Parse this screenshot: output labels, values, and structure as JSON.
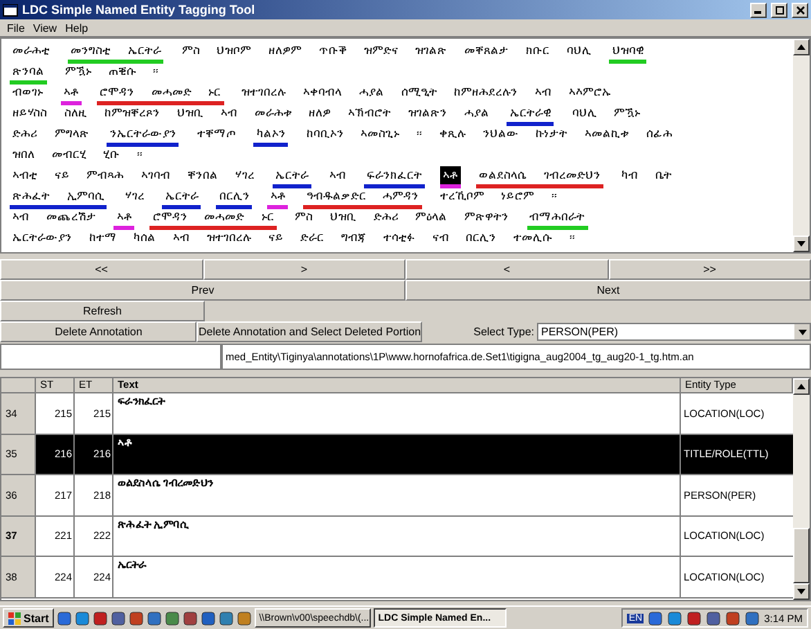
{
  "window": {
    "title": "LDC Simple Named Entity Tagging Tool"
  },
  "menu": [
    "File",
    "View",
    "Help"
  ],
  "document": {
    "lines": [
      [
        {
          "text": "መራሕቲ",
          "selected": false
        },
        {
          "text": "መንግስቲ ኤርትራ",
          "color": "#22cc22",
          "selected": false
        },
        {
          "text": "ምስ ህዝቦም ዘለዎም ጥቡቕ ዝምድና ዝገልጽ መቐጸልታ ክቡር ባህሊ",
          "selected": false
        },
        {
          "text": "ህዝባዊ",
          "color": "#22cc22",
          "selected": false
        }
      ],
      [
        {
          "text": "ጽንባል",
          "color": "#22cc22",
          "selected": false
        },
        {
          "text": "ምዃኑ ጠቒሱ ።",
          "selected": false
        }
      ],
      [
        {
          "text": "ብወገኑ",
          "selected": false
        },
        {
          "text": "ኣቶ",
          "color": "#dd22dd",
          "selected": false
        },
        {
          "text": "ሮሞዳን መሓመድ ኑር",
          "color": "#dd2222",
          "selected": false
        },
        {
          "text": "ዝተገበረሉ ኣቀባብላ ሓያል ሰሚዒት ከምዘሕደረሉን ኣብ ኣእምሮኡ",
          "selected": false
        }
      ],
      [
        {
          "text": "ዘይሃስስ ስለዚ ከምዝቐረጾን ህዝቢ ኣብ መራሕቱ ዘለዎ ኣኽብሮት ዝገልጽን ሓያል",
          "selected": false
        },
        {
          "text": "ኤርትራዊ",
          "color": "#1122cc",
          "selected": false
        },
        {
          "text": "ባህሊ ምዃኑ",
          "selected": false
        }
      ],
      [
        {
          "text": "ድሕሪ ምግላጽ",
          "selected": false
        },
        {
          "text": "ንኤርትራውያን",
          "color": "#1122cc",
          "selected": false
        },
        {
          "text": "ተቐማጦ",
          "selected": false
        },
        {
          "text": "ካልኦን",
          "color": "#1122cc",
          "selected": false
        },
        {
          "text": "ከባቢኦን ኣመስጊኑ ። ቀጺሉ ንህልው ኩነታት ኣመልኪቱ ሰፊሕ",
          "selected": false
        }
      ],
      [
        {
          "text": "ዝበለ መብርሂ ሂቡ ።",
          "selected": false
        }
      ],
      [
        {
          "text": "ኣብቲ ናይ ምብጻሕ ኣገባብ ቐንበል ሃገረ",
          "selected": false
        },
        {
          "text": "ኤርትራ",
          "color": "#1122cc",
          "selected": false
        },
        {
          "text": "ኣብ",
          "selected": false
        },
        {
          "text": "ፍራንክፈርት",
          "color": "#1122cc",
          "selected": false
        },
        {
          "text": "ኣቶ",
          "color": "#dd22dd",
          "selected": true
        },
        {
          "text": "ወልደስላሴ ገብረመድህን",
          "color": "#dd2222",
          "selected": false
        },
        {
          "text": "ካብ ቤት",
          "selected": false
        }
      ],
      [
        {
          "text": "ጽሕፈት ኢምባሲ",
          "color": "#1122cc",
          "selected": false
        },
        {
          "text": "ሃገረ",
          "selected": false
        },
        {
          "text": "ኤርትራ",
          "color": "#1122cc",
          "selected": false
        },
        {
          "text": "በርሊን",
          "color": "#1122cc",
          "selected": false
        },
        {
          "text": "ኣቶ",
          "color": "#dd22dd",
          "selected": false
        },
        {
          "text": "ዓብዱልቃድር ሓምዳን",
          "color": "#dd2222",
          "selected": false
        },
        {
          "text": "ተረኺቦም ነይሮም ።",
          "selected": false
        }
      ],
      [
        {
          "text": "ኣብ መጨረሽታ",
          "selected": false
        },
        {
          "text": "ኣቶ",
          "color": "#dd22dd",
          "selected": false
        },
        {
          "text": "ሮሞዳን መሓመድ ኑር",
          "color": "#dd2222",
          "selected": false
        },
        {
          "text": "ምስ ህዝቢ ድሕሪ ምዕላል ምጽዋትን",
          "selected": false
        },
        {
          "text": "ብማሕበራት",
          "color": "#22cc22",
          "selected": false
        }
      ],
      [
        {
          "text": "ኤርትራውያን ከተማ ካሰል ኣብ ዝተገበረሉ ናይ ድራር ግብጃ ተሳቲፉ ናብ በርሊን ተመሊሱ ።",
          "selected": false
        }
      ]
    ]
  },
  "nav": {
    "buttons": [
      "<<",
      ">",
      "<",
      ">>"
    ],
    "prev": "Prev",
    "next": "Next",
    "refresh": "Refresh",
    "delete": "Delete Annotation",
    "delete_select": "Delete Annotation and Select Deleted Portion",
    "select_label": "Select Type:",
    "select_value": "PERSON(PER)",
    "path": "med_Entity\\Tiginya\\annotations\\1P\\www.hornofafrica.de.Set1\\tigigna_aug2004_tg_aug20-1_tg.htm.an"
  },
  "table": {
    "columns": [
      "ST",
      "ET",
      "Text",
      "Entity Type"
    ],
    "rows": [
      {
        "index": "34",
        "st": "215",
        "et": "215",
        "text": "ፍራንክፈርት",
        "type": "LOCATION(LOC)",
        "selected": false,
        "focused": false
      },
      {
        "index": "35",
        "st": "216",
        "et": "216",
        "text": "ኣቶ",
        "type": "TITLE/ROLE(TTL)",
        "selected": true,
        "focused": false
      },
      {
        "index": "36",
        "st": "217",
        "et": "218",
        "text": "ወልደስላሴ ገብረመድህን",
        "type": "PERSON(PER)",
        "selected": false,
        "focused": false
      },
      {
        "index": "37",
        "st": "221",
        "et": "222",
        "text": "ጽሕፈት ኢምባሲ",
        "type": "LOCATION(LOC)",
        "selected": false,
        "focused": true
      },
      {
        "index": "38",
        "st": "224",
        "et": "224",
        "text": "ኤርትራ",
        "type": "LOCATION(LOC)",
        "selected": false,
        "focused": false
      }
    ]
  },
  "taskbar": {
    "start": "Start",
    "tasks": [
      {
        "label": "\\\\Brown\\v00\\speechdb\\(...",
        "selected": false
      },
      {
        "label": "LDC Simple Named En...",
        "selected": true
      }
    ],
    "lang": "EN",
    "time": "3:14 PM"
  }
}
